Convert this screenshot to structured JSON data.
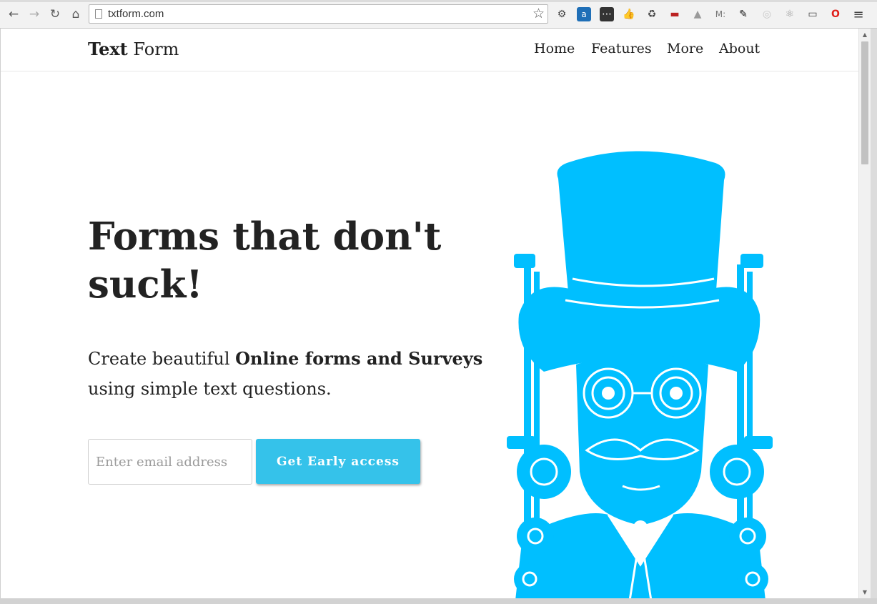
{
  "browser": {
    "url": "txtform.com",
    "extensions": [
      {
        "icon": "gear-icon",
        "glyph": "⚙"
      },
      {
        "icon": "amazon-icon",
        "glyph": "a"
      },
      {
        "icon": "dots-icon",
        "glyph": "⋯"
      },
      {
        "icon": "thumbs-up-icon",
        "glyph": "👍"
      },
      {
        "icon": "recycle-icon",
        "glyph": "♻"
      },
      {
        "icon": "mask-icon",
        "glyph": "▬"
      },
      {
        "icon": "drive-icon",
        "glyph": "▲"
      },
      {
        "icon": "m-icon",
        "glyph": "M:"
      },
      {
        "icon": "flag-icon",
        "glyph": "✎"
      },
      {
        "icon": "circle-icon",
        "glyph": "◎"
      },
      {
        "icon": "atom-icon",
        "glyph": "⚛"
      },
      {
        "icon": "cast-icon",
        "glyph": "▭"
      },
      {
        "icon": "opera-icon",
        "glyph": "O"
      },
      {
        "icon": "menu-icon",
        "glyph": "≡"
      }
    ]
  },
  "site": {
    "brand_bold": "Text",
    "brand_light": "Form",
    "nav": [
      "Home",
      "Features",
      "More",
      "About"
    ]
  },
  "hero": {
    "headline_line1": "Forms that don't",
    "headline_line2": "suck!",
    "sub_prefix": "Create beautiful ",
    "sub_bold": "Online forms and Surveys",
    "sub_suffix": "using simple text questions.",
    "email_placeholder": "Enter email address",
    "cta_label": "Get Early access"
  },
  "colors": {
    "accent": "#35c2ea",
    "illustration": "#00bfff"
  }
}
